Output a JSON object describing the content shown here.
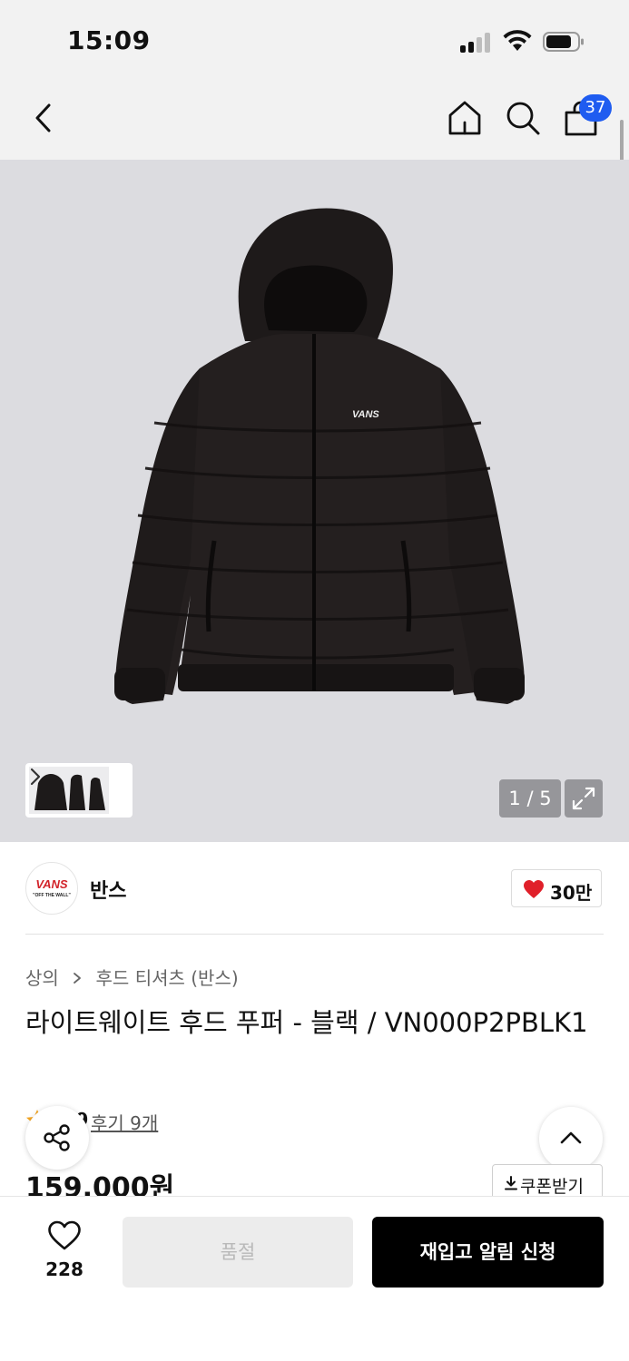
{
  "status_bar": {
    "time": "15:09"
  },
  "nav": {
    "cart_count": "37"
  },
  "gallery": {
    "page_indicator": "1 / 5",
    "background_color": "#dcdce0"
  },
  "brand": {
    "logo_word": "VANS",
    "logo_tagline": "\"OFF THE WALL\"",
    "name": "반스",
    "like_count": "30만"
  },
  "product": {
    "breadcrumb": [
      "상의",
      "후드 티셔츠 (반스)"
    ],
    "title": "라이트웨이트 후드 푸퍼 - 블랙 / VN000P2PBLK1",
    "rating": "4.9",
    "review_link": "후기 9개",
    "price": "159,000원",
    "coupon_label": "쿠폰받기",
    "print_logo": "VANS"
  },
  "bottom_bar": {
    "wish_count": "228",
    "soldout_label": "품절",
    "restock_label": "재입고 알림 신청"
  },
  "colors": {
    "accent_blue": "#1f5cf0",
    "heart_red": "#e0202a",
    "star_orange": "#f5a623",
    "primary_black": "#000000"
  },
  "icons": [
    "back-icon",
    "home-icon",
    "search-icon",
    "bag-icon",
    "chevron-right-icon",
    "expand-icon",
    "heart-filled-icon",
    "star-icon",
    "share-icon",
    "chevron-up-icon",
    "download-icon",
    "heart-outline-icon"
  ]
}
